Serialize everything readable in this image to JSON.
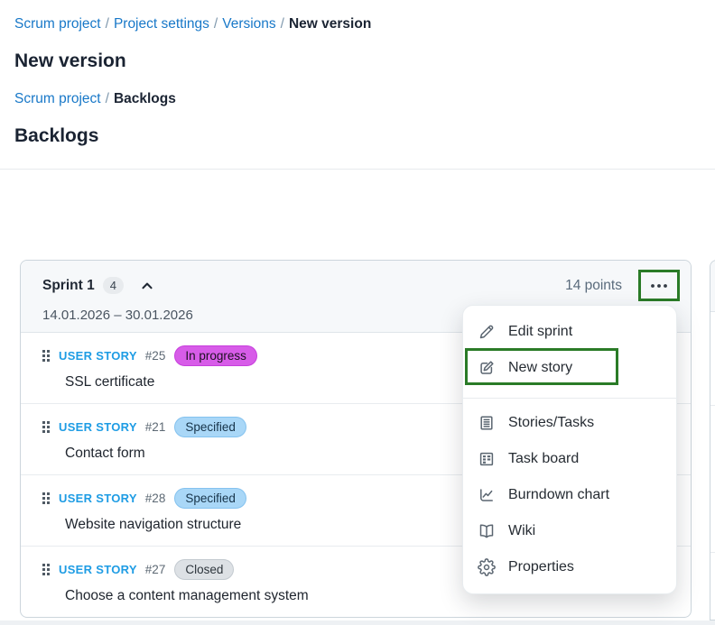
{
  "colors": {
    "accent_green": "#2a7b27",
    "link_blue": "#1878c8",
    "user_story_blue": "#1e9ce4",
    "status_in_progress_bg": "#d75ce8",
    "status_specified_bg": "#a9d7f7",
    "status_closed_bg": "#dde1e5",
    "card_header_bg": "#f6f8fa"
  },
  "breadcrumb_top": {
    "separator": "/",
    "items": [
      {
        "label": "Scrum project"
      },
      {
        "label": "Project settings"
      },
      {
        "label": "Versions"
      },
      {
        "label": "New version"
      }
    ]
  },
  "page_title": "New version",
  "breadcrumb_second": {
    "separator": "/",
    "items": [
      {
        "label": "Scrum project"
      },
      {
        "label": "Backlogs"
      }
    ]
  },
  "section_title": "Backlogs",
  "sprint": {
    "name": "Sprint 1",
    "count": "4",
    "collapse_icon": "chevron-up-icon",
    "date_range": "14.01.2026 – 30.01.2026",
    "points": "14 points",
    "more_icon": "more-horizontal-icon"
  },
  "stories": [
    {
      "type_label": "USER STORY",
      "id": "#25",
      "status": "In progress",
      "title": "SSL certificate"
    },
    {
      "type_label": "USER STORY",
      "id": "#21",
      "status": "Specified",
      "title": "Contact form"
    },
    {
      "type_label": "USER STORY",
      "id": "#28",
      "status": "Specified",
      "title": "Website navigation structure"
    },
    {
      "type_label": "USER STORY",
      "id": "#27",
      "status": "Closed",
      "title": "Choose a content management system"
    }
  ],
  "menu": {
    "group1": [
      {
        "icon": "pencil-icon",
        "label": "Edit sprint"
      },
      {
        "icon": "compose-icon",
        "label": "New story",
        "highlighted": true
      }
    ],
    "group2": [
      {
        "icon": "document-lines-icon",
        "label": "Stories/Tasks"
      },
      {
        "icon": "board-icon",
        "label": "Task board"
      },
      {
        "icon": "line-chart-icon",
        "label": "Burndown chart"
      },
      {
        "icon": "open-book-icon",
        "label": "Wiki"
      },
      {
        "icon": "gear-icon",
        "label": "Properties"
      }
    ]
  }
}
